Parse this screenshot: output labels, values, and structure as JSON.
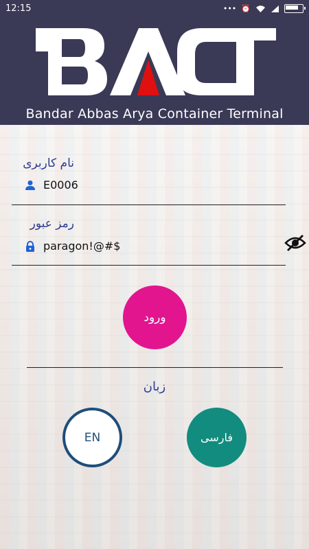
{
  "status_bar": {
    "time": "12:15"
  },
  "header": {
    "logo_text": "BACT",
    "tagline": "Bandar Abbas Arya Container Terminal"
  },
  "form": {
    "username_label": "نام کاربری",
    "username_value": "E0006",
    "password_label": "رمز عبور",
    "password_value": "paragon!@#$"
  },
  "buttons": {
    "login_label": "ورود",
    "language_label": "زبان",
    "english_label": "EN",
    "persian_label": "فارسی"
  },
  "colors": {
    "header_bg": "#3a3956",
    "login_btn": "#e2158f",
    "persian_btn": "#128c7e",
    "english_border": "#1f4e7a",
    "label_color": "#2f3b8f"
  }
}
